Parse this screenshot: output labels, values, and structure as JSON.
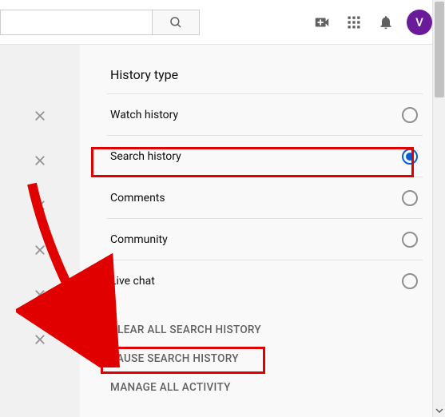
{
  "header": {
    "search_value": "",
    "search_placeholder": "",
    "avatar_letter": "V"
  },
  "panel": {
    "title": "History type",
    "options": [
      {
        "label": "Watch history",
        "selected": false
      },
      {
        "label": "Search history",
        "selected": true
      },
      {
        "label": "Comments",
        "selected": false
      },
      {
        "label": "Community",
        "selected": false
      },
      {
        "label": "Live chat",
        "selected": false
      }
    ],
    "actions": [
      {
        "label": "CLEAR ALL SEARCH HISTORY"
      },
      {
        "label": "PAUSE SEARCH HISTORY"
      },
      {
        "label": "MANAGE ALL ACTIVITY"
      }
    ]
  },
  "annotations": {
    "highlight_option_index": 1,
    "highlight_action_index": 1
  }
}
